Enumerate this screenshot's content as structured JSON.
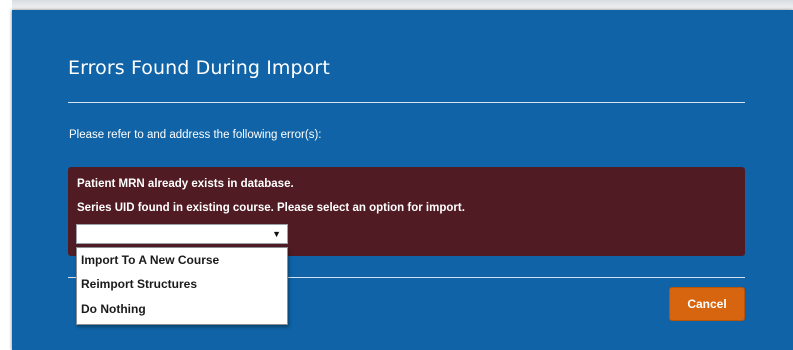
{
  "dialog": {
    "title": "Errors Found During Import",
    "intro": "Please refer to and address the following error(s):",
    "errors": [
      "Patient MRN already exists in database.",
      "Series UID found in existing course. Please select an option for import."
    ],
    "select": {
      "value": "",
      "caret": "▼",
      "options": [
        "Import To A New Course",
        "Reimport Structures",
        "Do Nothing"
      ]
    },
    "cancel_label": "Cancel"
  },
  "colors": {
    "dialog_bg": "#0f63a6",
    "error_bg": "#501b22",
    "cancel_bg": "#d7650f"
  }
}
